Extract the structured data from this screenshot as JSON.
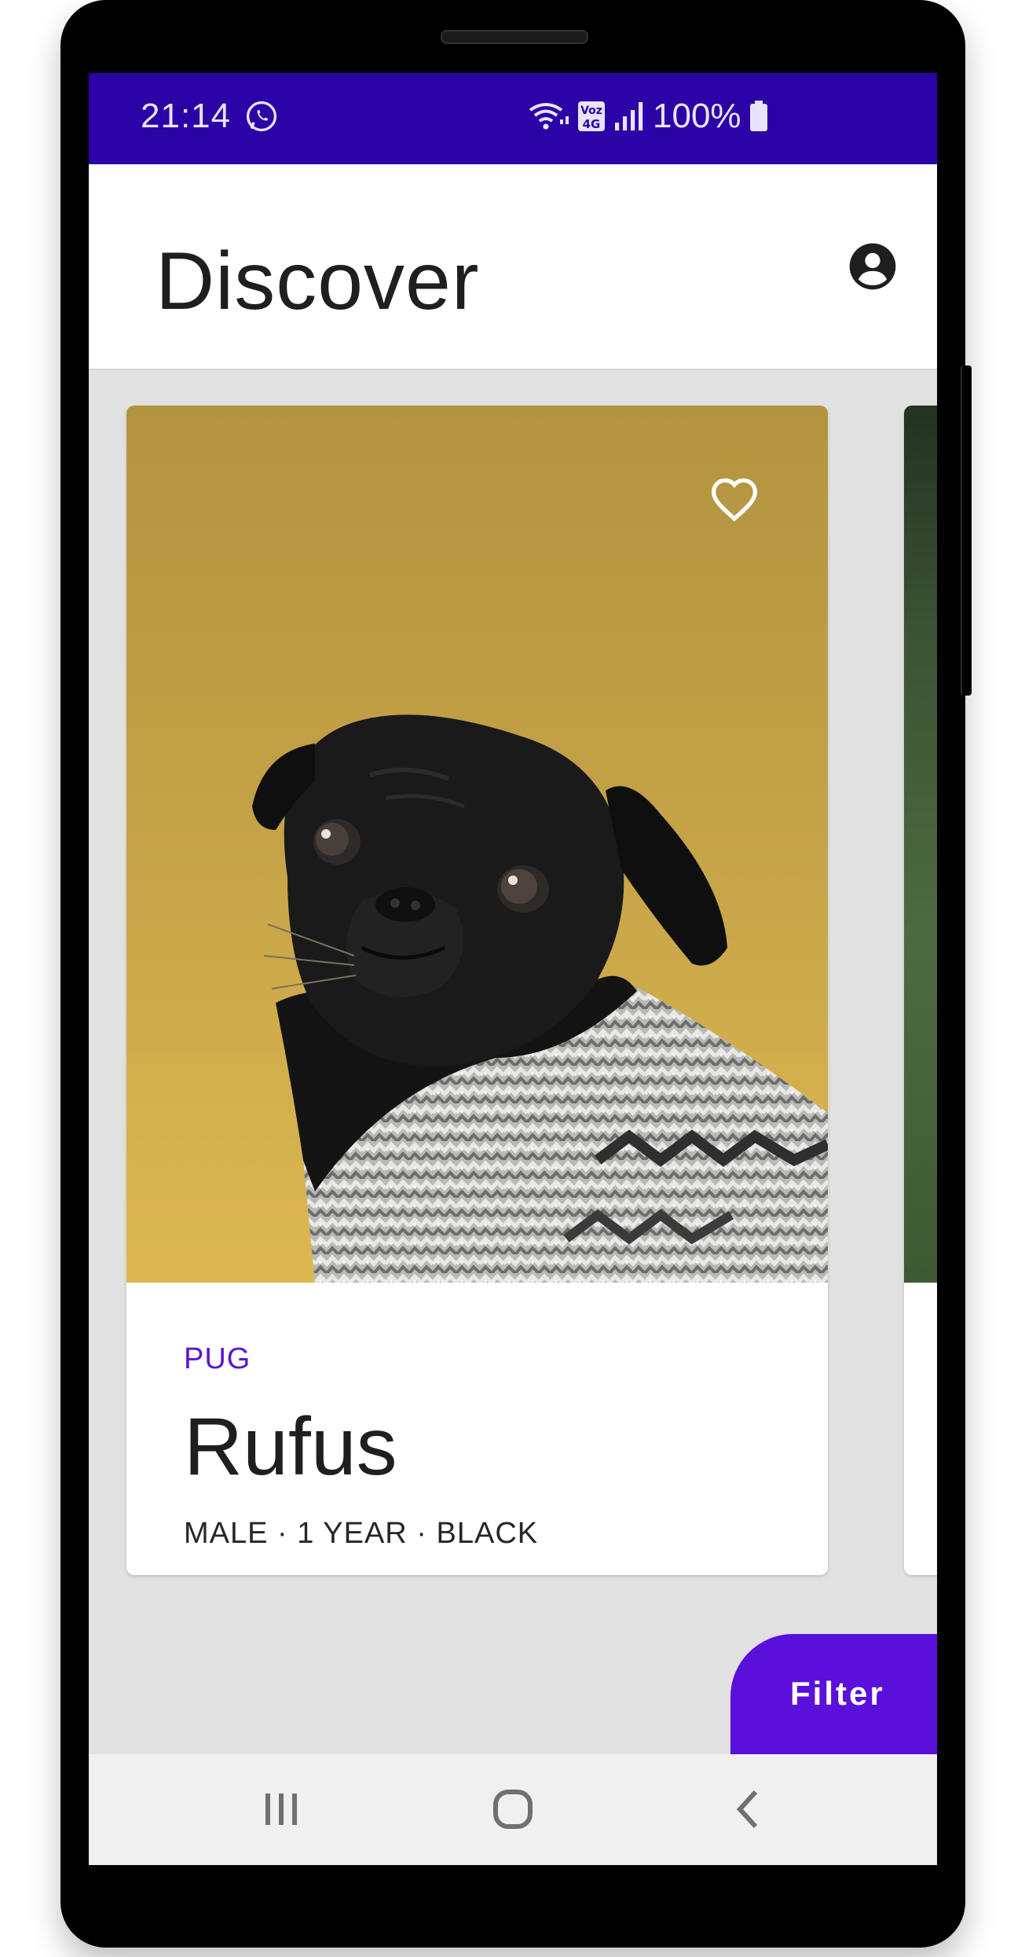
{
  "status_bar": {
    "time": "21:14",
    "network_label": "Voz 4G",
    "battery": "100%",
    "background": "#2c03a6",
    "icons": [
      "whatsapp-icon",
      "wifi-icon",
      "volte-4g-icon",
      "signal-icon",
      "battery-icon"
    ]
  },
  "app_bar": {
    "title": "Discover",
    "account_icon": "account-circle-icon"
  },
  "cards": [
    {
      "breed": "PUG",
      "name": "Rufus",
      "details": "MALE · 1 YEAR · BLACK",
      "image": "black-pug-in-knit-sweater-on-yellow-background",
      "favorite_icon": "heart-outline-icon"
    }
  ],
  "fab": {
    "label": "Filter",
    "color": "#5a0fdb"
  },
  "nav_bar": {
    "buttons": [
      "recents-icon",
      "home-icon",
      "back-icon"
    ]
  },
  "colors": {
    "accent": "#5a14d6",
    "screen_background": "#e1e1e1"
  }
}
